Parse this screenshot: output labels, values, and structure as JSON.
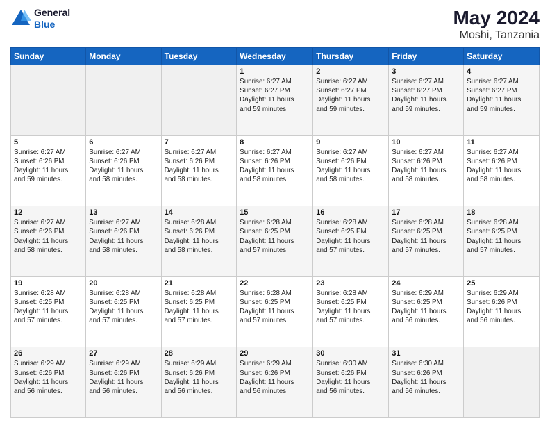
{
  "header": {
    "logo_line1": "General",
    "logo_line2": "Blue",
    "main_title": "May 2024",
    "subtitle": "Moshi, Tanzania"
  },
  "days_of_week": [
    "Sunday",
    "Monday",
    "Tuesday",
    "Wednesday",
    "Thursday",
    "Friday",
    "Saturday"
  ],
  "weeks": [
    [
      {
        "day": "",
        "info": ""
      },
      {
        "day": "",
        "info": ""
      },
      {
        "day": "",
        "info": ""
      },
      {
        "day": "1",
        "info": "Sunrise: 6:27 AM\nSunset: 6:27 PM\nDaylight: 11 hours\nand 59 minutes."
      },
      {
        "day": "2",
        "info": "Sunrise: 6:27 AM\nSunset: 6:27 PM\nDaylight: 11 hours\nand 59 minutes."
      },
      {
        "day": "3",
        "info": "Sunrise: 6:27 AM\nSunset: 6:27 PM\nDaylight: 11 hours\nand 59 minutes."
      },
      {
        "day": "4",
        "info": "Sunrise: 6:27 AM\nSunset: 6:27 PM\nDaylight: 11 hours\nand 59 minutes."
      }
    ],
    [
      {
        "day": "5",
        "info": "Sunrise: 6:27 AM\nSunset: 6:26 PM\nDaylight: 11 hours\nand 59 minutes."
      },
      {
        "day": "6",
        "info": "Sunrise: 6:27 AM\nSunset: 6:26 PM\nDaylight: 11 hours\nand 58 minutes."
      },
      {
        "day": "7",
        "info": "Sunrise: 6:27 AM\nSunset: 6:26 PM\nDaylight: 11 hours\nand 58 minutes."
      },
      {
        "day": "8",
        "info": "Sunrise: 6:27 AM\nSunset: 6:26 PM\nDaylight: 11 hours\nand 58 minutes."
      },
      {
        "day": "9",
        "info": "Sunrise: 6:27 AM\nSunset: 6:26 PM\nDaylight: 11 hours\nand 58 minutes."
      },
      {
        "day": "10",
        "info": "Sunrise: 6:27 AM\nSunset: 6:26 PM\nDaylight: 11 hours\nand 58 minutes."
      },
      {
        "day": "11",
        "info": "Sunrise: 6:27 AM\nSunset: 6:26 PM\nDaylight: 11 hours\nand 58 minutes."
      }
    ],
    [
      {
        "day": "12",
        "info": "Sunrise: 6:27 AM\nSunset: 6:26 PM\nDaylight: 11 hours\nand 58 minutes."
      },
      {
        "day": "13",
        "info": "Sunrise: 6:27 AM\nSunset: 6:26 PM\nDaylight: 11 hours\nand 58 minutes."
      },
      {
        "day": "14",
        "info": "Sunrise: 6:28 AM\nSunset: 6:26 PM\nDaylight: 11 hours\nand 58 minutes."
      },
      {
        "day": "15",
        "info": "Sunrise: 6:28 AM\nSunset: 6:25 PM\nDaylight: 11 hours\nand 57 minutes."
      },
      {
        "day": "16",
        "info": "Sunrise: 6:28 AM\nSunset: 6:25 PM\nDaylight: 11 hours\nand 57 minutes."
      },
      {
        "day": "17",
        "info": "Sunrise: 6:28 AM\nSunset: 6:25 PM\nDaylight: 11 hours\nand 57 minutes."
      },
      {
        "day": "18",
        "info": "Sunrise: 6:28 AM\nSunset: 6:25 PM\nDaylight: 11 hours\nand 57 minutes."
      }
    ],
    [
      {
        "day": "19",
        "info": "Sunrise: 6:28 AM\nSunset: 6:25 PM\nDaylight: 11 hours\nand 57 minutes."
      },
      {
        "day": "20",
        "info": "Sunrise: 6:28 AM\nSunset: 6:25 PM\nDaylight: 11 hours\nand 57 minutes."
      },
      {
        "day": "21",
        "info": "Sunrise: 6:28 AM\nSunset: 6:25 PM\nDaylight: 11 hours\nand 57 minutes."
      },
      {
        "day": "22",
        "info": "Sunrise: 6:28 AM\nSunset: 6:25 PM\nDaylight: 11 hours\nand 57 minutes."
      },
      {
        "day": "23",
        "info": "Sunrise: 6:28 AM\nSunset: 6:25 PM\nDaylight: 11 hours\nand 57 minutes."
      },
      {
        "day": "24",
        "info": "Sunrise: 6:29 AM\nSunset: 6:25 PM\nDaylight: 11 hours\nand 56 minutes."
      },
      {
        "day": "25",
        "info": "Sunrise: 6:29 AM\nSunset: 6:26 PM\nDaylight: 11 hours\nand 56 minutes."
      }
    ],
    [
      {
        "day": "26",
        "info": "Sunrise: 6:29 AM\nSunset: 6:26 PM\nDaylight: 11 hours\nand 56 minutes."
      },
      {
        "day": "27",
        "info": "Sunrise: 6:29 AM\nSunset: 6:26 PM\nDaylight: 11 hours\nand 56 minutes."
      },
      {
        "day": "28",
        "info": "Sunrise: 6:29 AM\nSunset: 6:26 PM\nDaylight: 11 hours\nand 56 minutes."
      },
      {
        "day": "29",
        "info": "Sunrise: 6:29 AM\nSunset: 6:26 PM\nDaylight: 11 hours\nand 56 minutes."
      },
      {
        "day": "30",
        "info": "Sunrise: 6:30 AM\nSunset: 6:26 PM\nDaylight: 11 hours\nand 56 minutes."
      },
      {
        "day": "31",
        "info": "Sunrise: 6:30 AM\nSunset: 6:26 PM\nDaylight: 11 hours\nand 56 minutes."
      },
      {
        "day": "",
        "info": ""
      }
    ]
  ]
}
